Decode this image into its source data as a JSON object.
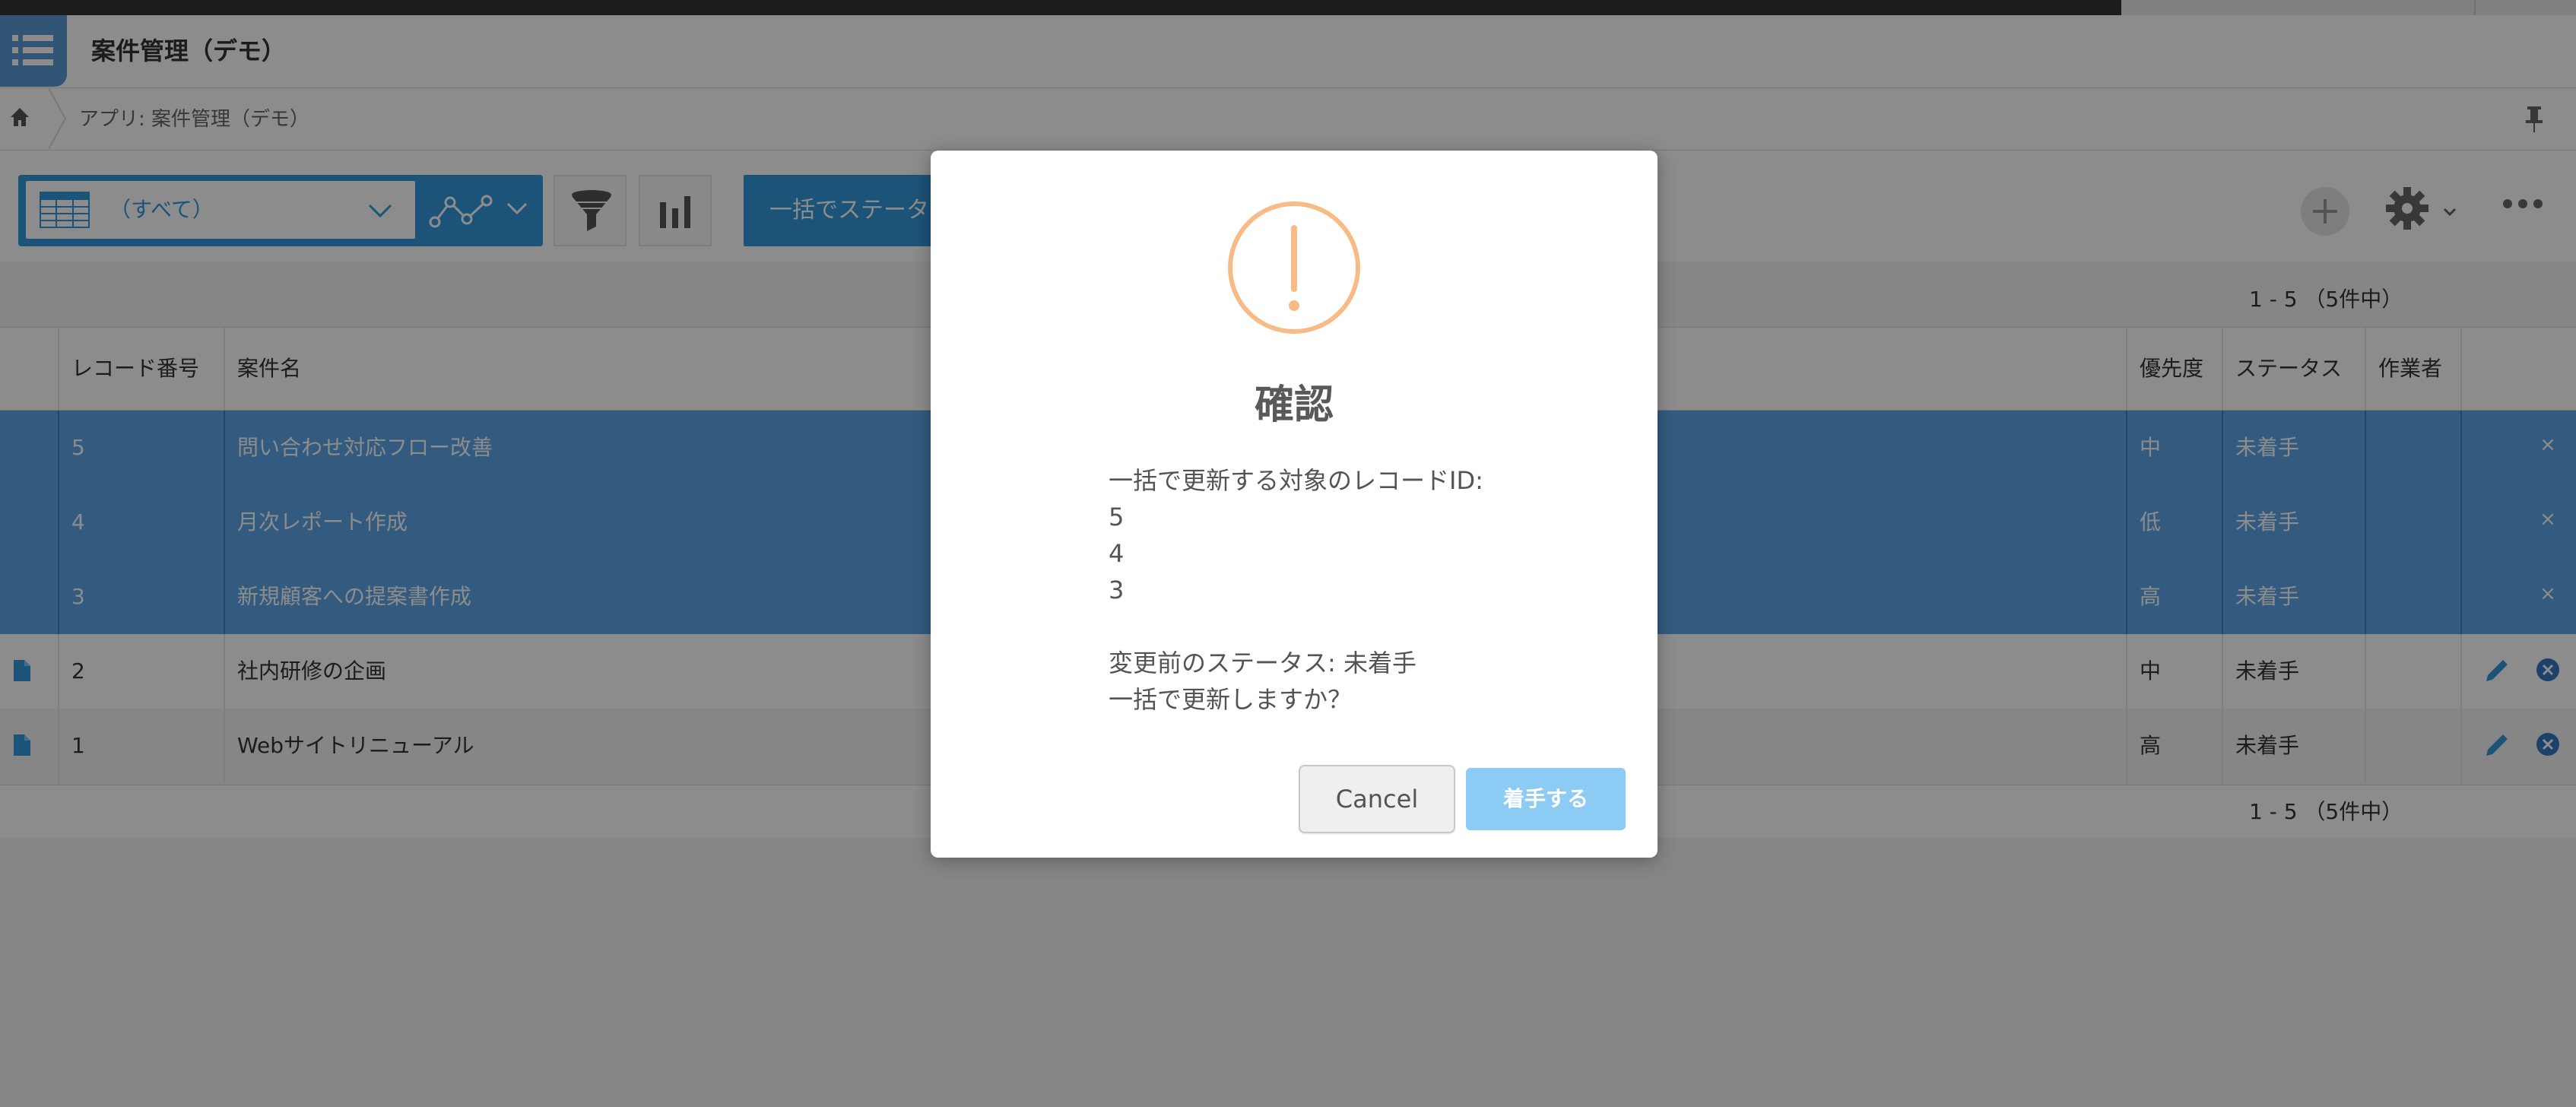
{
  "app": {
    "title": "案件管理（デモ）",
    "breadcrumb": "アプリ: 案件管理（デモ）"
  },
  "toolbar": {
    "view_label": "（すべて）",
    "bulk_button_label": "一括でステータス"
  },
  "pager": {
    "top": "1 - 5 （5件中）",
    "bottom": "1 - 5 （5件中）"
  },
  "table": {
    "headers": {
      "record_no": "レコード番号",
      "title": "案件名",
      "priority": "優先度",
      "status": "ステータス",
      "assignee": "作業者"
    },
    "rows": [
      {
        "id": "5",
        "title": "問い合わせ対応フロー改善",
        "priority": "中",
        "status": "未着手",
        "assignee": "",
        "selected": true
      },
      {
        "id": "4",
        "title": "月次レポート作成",
        "priority": "低",
        "status": "未着手",
        "assignee": "",
        "selected": true
      },
      {
        "id": "3",
        "title": "新規顧客への提案書作成",
        "priority": "高",
        "status": "未着手",
        "assignee": "",
        "selected": true
      },
      {
        "id": "2",
        "title": "社内研修の企画",
        "priority": "中",
        "status": "未着手",
        "assignee": "",
        "selected": false
      },
      {
        "id": "1",
        "title": "Webサイトリニューアル",
        "priority": "高",
        "status": "未着手",
        "assignee": "",
        "selected": false
      }
    ]
  },
  "dialog": {
    "title": "確認",
    "lines": [
      "一括で更新する対象のレコードID:",
      "5",
      "4",
      "3",
      "",
      "変更前のステータス: 未着手",
      "一括で更新しますか？"
    ],
    "cancel_label": "Cancel",
    "confirm_label": "着手する"
  },
  "colors": {
    "accent": "#3498db",
    "selected_row": "#5ea6e8",
    "warning": "#f8bb86",
    "confirm_button": "#8ccbf4"
  },
  "icons": {
    "app_menu": "list-icon",
    "home": "home-icon",
    "pin": "pin-icon",
    "view_table": "table-icon",
    "graph": "graph-icon",
    "filter": "filter-icon",
    "chart": "bar-chart-icon",
    "add": "plus-icon",
    "settings": "gear-icon",
    "more": "more-icon",
    "record": "document-icon",
    "edit": "pencil-icon",
    "delete": "delete-icon",
    "warning": "warning-icon"
  }
}
